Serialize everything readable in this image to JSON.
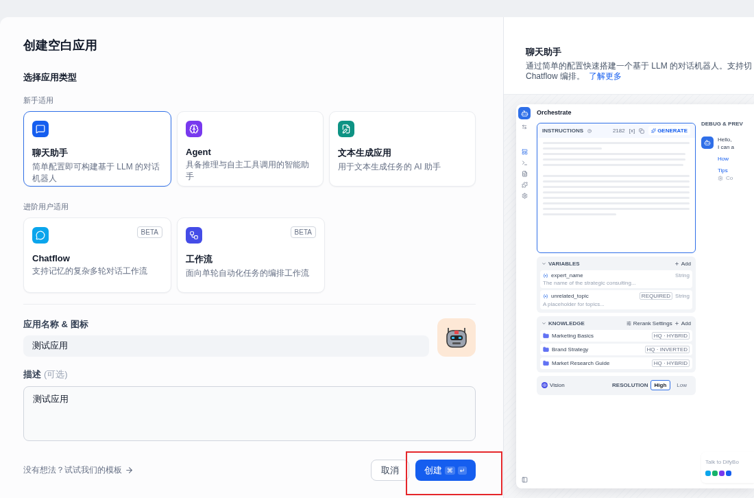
{
  "dialog": {
    "title": "创建空白应用"
  },
  "type_section": {
    "heading": "选择应用类型",
    "groups": [
      {
        "label": "新手适用",
        "options": [
          {
            "title": "聊天助手",
            "description": "简单配置即可构建基于 LLM 的对话机器人",
            "color": "#155eef",
            "selected": true
          },
          {
            "title": "Agent",
            "description": "具备推理与自主工具调用的智能助手",
            "color": "#7839ee",
            "selected": false
          },
          {
            "title": "文本生成应用",
            "description": "用于文本生成任务的 AI 助手",
            "color": "#0e9384",
            "selected": false
          }
        ]
      },
      {
        "label": "进阶用户适用",
        "options": [
          {
            "title": "Chatflow",
            "description": "支持记忆的复杂多轮对话工作流",
            "color": "#0ba5ec",
            "badge": "BETA",
            "selected": false
          },
          {
            "title": "工作流",
            "description": "面向单轮自动化任务的编排工作流",
            "color": "#444ce7",
            "badge": "BETA",
            "selected": false
          }
        ]
      }
    ]
  },
  "name_field": {
    "label": "应用名称 & 图标",
    "value": "测试应用"
  },
  "description_field": {
    "label": "描述",
    "hint": "(可选)",
    "value": "测试应用"
  },
  "footer": {
    "template_link": "没有想法？试试我们的模板",
    "cancel": "取消",
    "create": "创建",
    "shortcut_keys": [
      "⌘",
      "↵"
    ]
  },
  "preview": {
    "title": "聊天助手",
    "description": "通过简单的配置快速搭建一个基于 LLM 的对话机器人。支持切",
    "description_line2": "Chatflow 编排。",
    "link": "了解更多",
    "screenshot": {
      "heading": "Orchestrate",
      "instructions": {
        "label": "INSTRUCTIONS",
        "count": "2182",
        "var_button": "[x]",
        "generate": "GENERATE"
      },
      "variables": {
        "label": "VARIABLES",
        "add": "Add",
        "rows": [
          {
            "name": "expert_name",
            "description": "The name of the strategic consulting...",
            "type": "String"
          },
          {
            "name": "unrelated_topic",
            "description": "A placeholder for topics...",
            "tag": "REQUIRED",
            "type": "String"
          }
        ]
      },
      "knowledge": {
        "label": "KNOWLEDGE",
        "rerank": "Rerank Settings",
        "add": "Add",
        "items": [
          {
            "name": "Marketing Basics",
            "tag": "HQ · HYBRID"
          },
          {
            "name": "Brand Strategy",
            "tag": "HQ · INVERTED"
          },
          {
            "name": "Market Research Guide",
            "tag": "HQ · HYBRID"
          }
        ]
      },
      "vision": {
        "label": "Vision",
        "resolution_label": "RESOLUTION",
        "options": [
          {
            "label": "High",
            "selected": true
          },
          {
            "label": "Low",
            "selected": false
          }
        ]
      },
      "debug": {
        "heading": "DEBUG & PREV",
        "message_lines": [
          "Hello,",
          "I can a"
        ],
        "suggestions": [
          "How",
          "Tips"
        ],
        "note": "Co",
        "input_placeholder": "Talk to DifyBo"
      }
    }
  }
}
